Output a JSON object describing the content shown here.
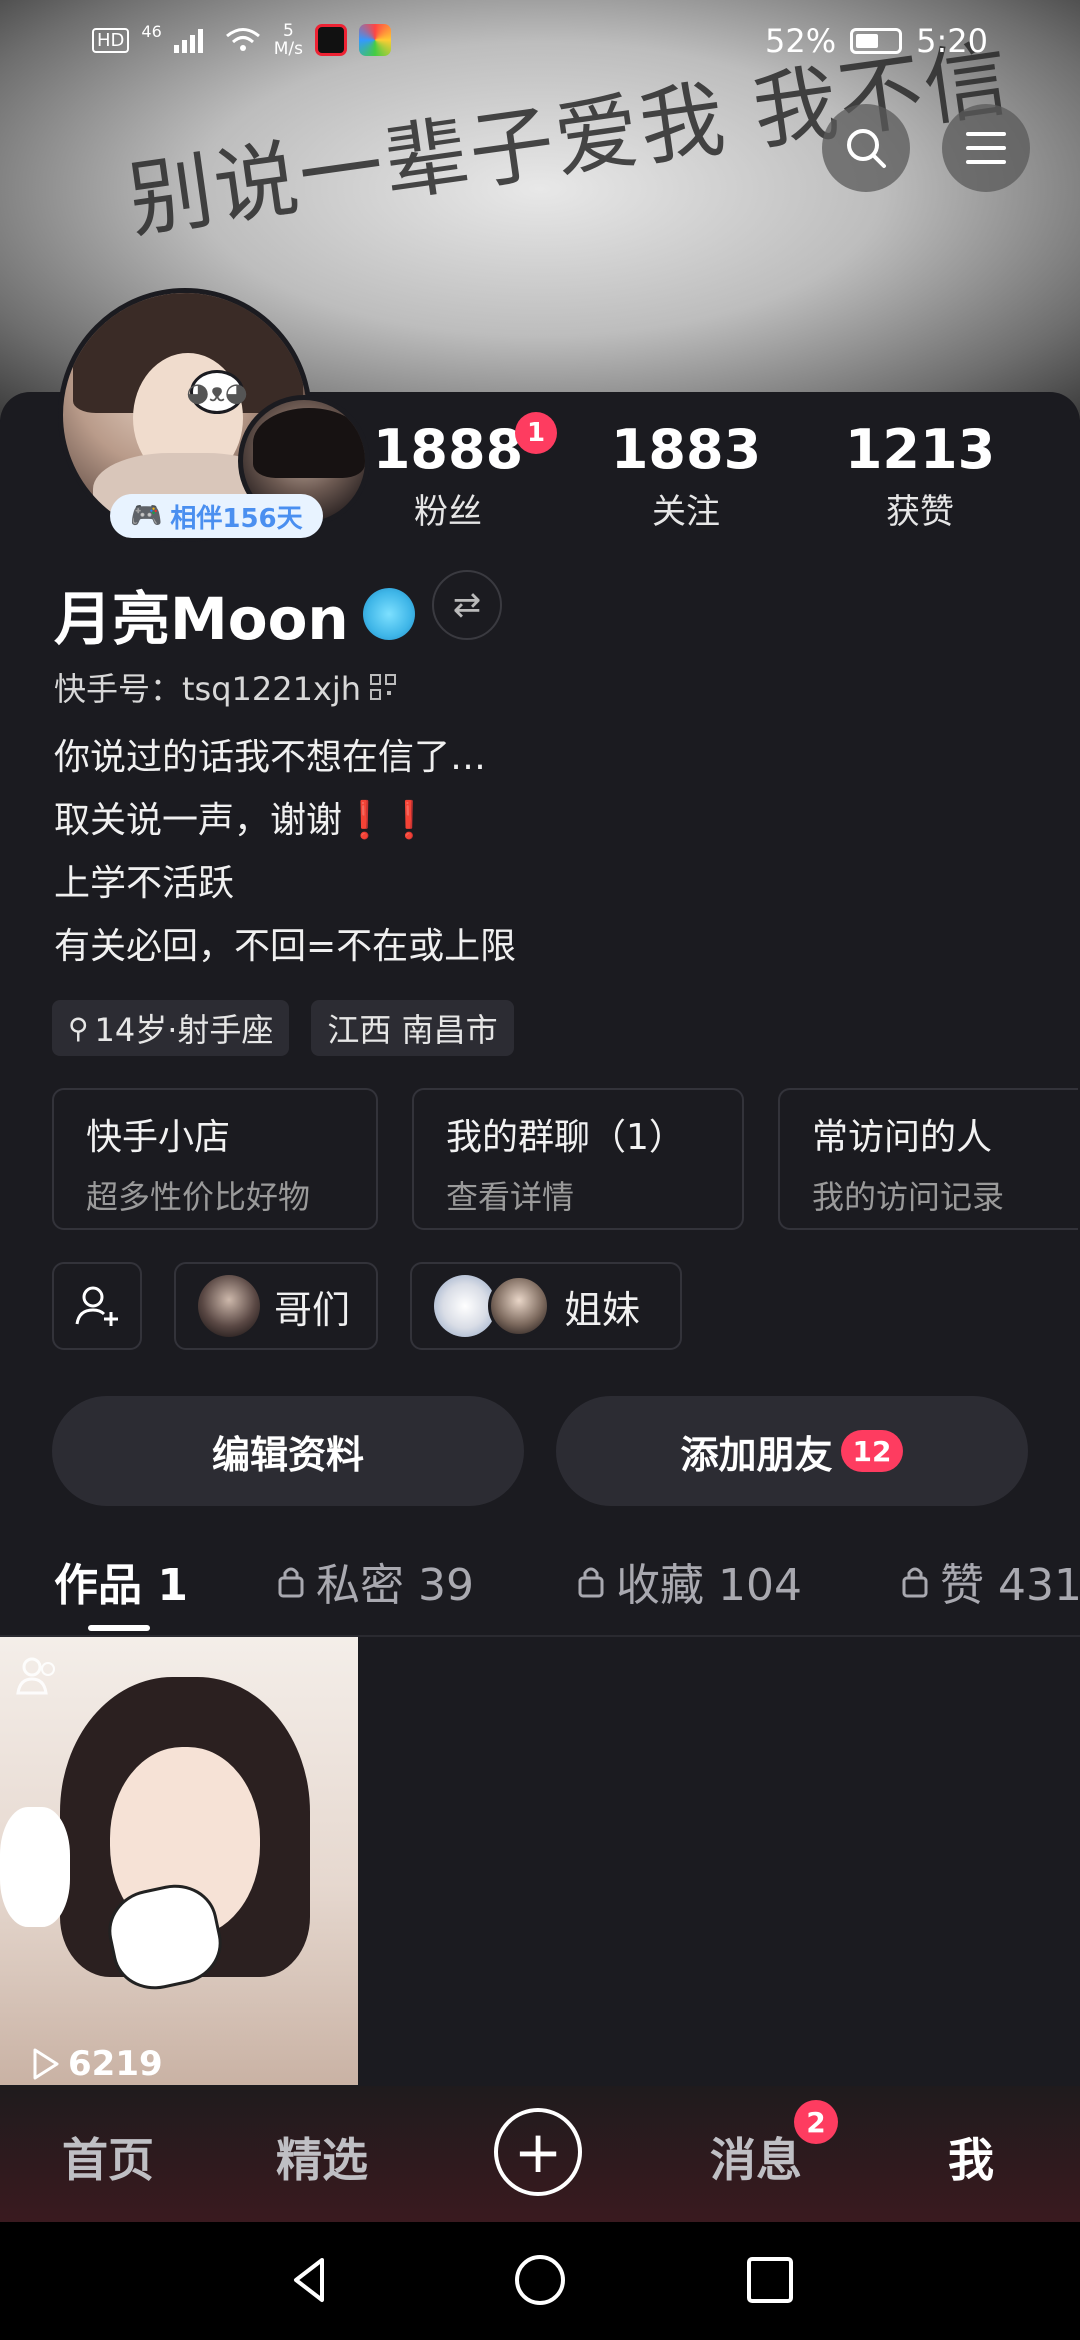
{
  "status_bar": {
    "left_labels": [
      "HD",
      "46",
      "5",
      "M/s"
    ],
    "battery": "52%",
    "time": "5:20"
  },
  "banner": {
    "text": "别说一辈子爱我 我不信"
  },
  "header_buttons": {
    "search_icon": "search-icon",
    "menu_icon": "menu-icon"
  },
  "profile": {
    "companion_badge": "相伴156天",
    "name": "月亮Moon",
    "kuaishou_id": "快手号：tsq1221xjh",
    "bio": [
      "你说过的话我不想在信了…",
      "取关说一声，谢谢❗❗",
      "上学不活跃",
      "有关必回，不回=不在或上限"
    ],
    "tags": [
      "14岁·射手座",
      "江西 南昌市"
    ]
  },
  "stats": [
    {
      "value": "1888",
      "label": "粉丝",
      "badge": "1"
    },
    {
      "value": "1883",
      "label": "关注"
    },
    {
      "value": "1213",
      "label": "获赞"
    }
  ],
  "shortcuts": [
    {
      "title": "快手小店",
      "subtitle": "超多性价比好物"
    },
    {
      "title": "我的群聊（1）",
      "subtitle": "查看详情"
    },
    {
      "title": "常访问的人",
      "subtitle": "我的访问记录"
    }
  ],
  "groups": [
    {
      "label": "哥们"
    },
    {
      "label": "姐妹"
    }
  ],
  "buttons": {
    "edit_profile": "编辑资料",
    "add_friends": "添加朋友",
    "add_friends_badge": "12"
  },
  "tabs": [
    {
      "label": "作品 1",
      "locked": false
    },
    {
      "label": "私密 39",
      "locked": true
    },
    {
      "label": "收藏 104",
      "locked": true
    },
    {
      "label": "赞 431",
      "locked": true
    }
  ],
  "works": [
    {
      "play_count": "6219"
    }
  ],
  "bottom_nav": {
    "items": [
      "首页",
      "精选",
      "消息",
      "我"
    ],
    "messages_badge": "2"
  },
  "colors": {
    "background": "#1b1b20",
    "badge": "#fe3c60",
    "companion_badge_text": "#4a8ff0"
  }
}
